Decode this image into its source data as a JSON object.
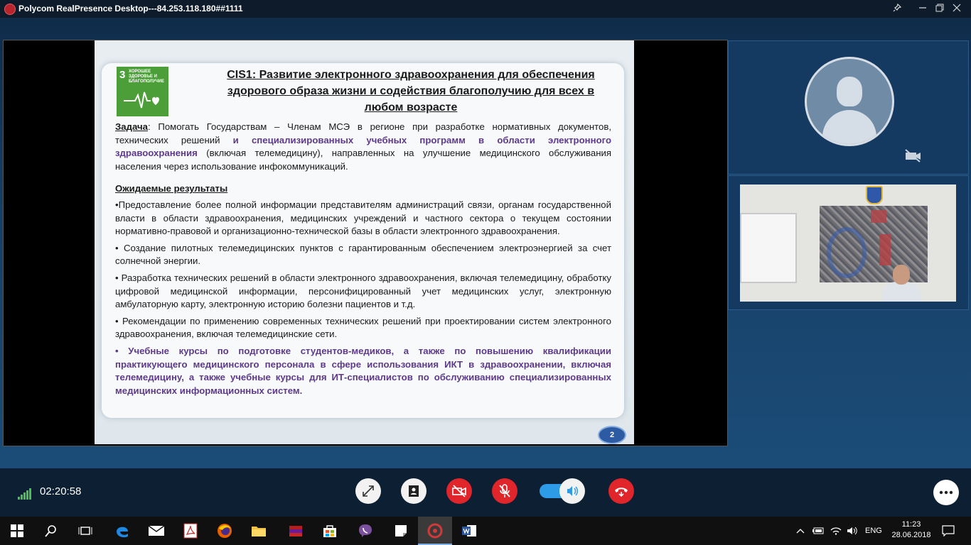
{
  "window": {
    "title": "Polycom RealPresence Desktop---84.253.118.180##1111"
  },
  "slide": {
    "sdg_number": "3",
    "sdg_label": "ХОРОШЕЕ ЗДОРОВЬЕ И БЛАГОПОЛУЧИЕ",
    "title_line1": "CIS1: Развитие электронного здравоохранения для обеспечения",
    "title_line2": "здорового образа жизни и содействия благополучию для всех в",
    "title_line3": "любом возрасте",
    "task_label": "Задача",
    "task_text_1": ": Помогать Государствам – Членам МСЭ в регионе при разработке нормативных документов, технических решений ",
    "task_highlight": "и специализированных учебных программ в области электронного здравоохранения",
    "task_text_2": " (включая телемедицину), направленных на улучшение медицинского обслуживания населения через использование инфокоммуникаций.",
    "results_heading": "Ожидаемые результаты",
    "bullet_1": "•Предоставление более полной информации представителям администраций связи, органам государственной власти в области здравоохранения, медицинских учреждений и частного сектора о текущем состоянии нормативно-правовой и организационно-технической базы в области электронного здравоохранения.",
    "bullet_2": "• Создание пилотных телемедицинских пунктов с гарантированным обеспечением электроэнергией за счет солнечной энергии.",
    "bullet_3": "• Разработка технических решений в области электронного здравоохранения, включая телемедицину, обработку цифровой медицинской информации, персонифицированный учет медицинских услуг, электронную амбулаторную карту, электронную историю болезни пациентов и т.д.",
    "bullet_4": "• Рекомендации по применению современных технических решений при проектировании систем электронного здравоохранения, включая телемедицинские сети.",
    "bullet_5": "• Учебные курсы по подготовке студентов-медиков, а также по повышению квалификации практикующего медицинского персонала в сфере использования ИКТ в здравоохранении, включая телемедицину, а также учебные курсы для ИТ-специалистов по обслуживанию специализированных медицинских информационных систем.",
    "page_number": "2"
  },
  "call": {
    "duration": "02:20:58",
    "signal_level": 5,
    "speaker_on": true
  },
  "taskbar": {
    "language": "ENG",
    "time": "11:23",
    "date": "28.06.2018"
  }
}
